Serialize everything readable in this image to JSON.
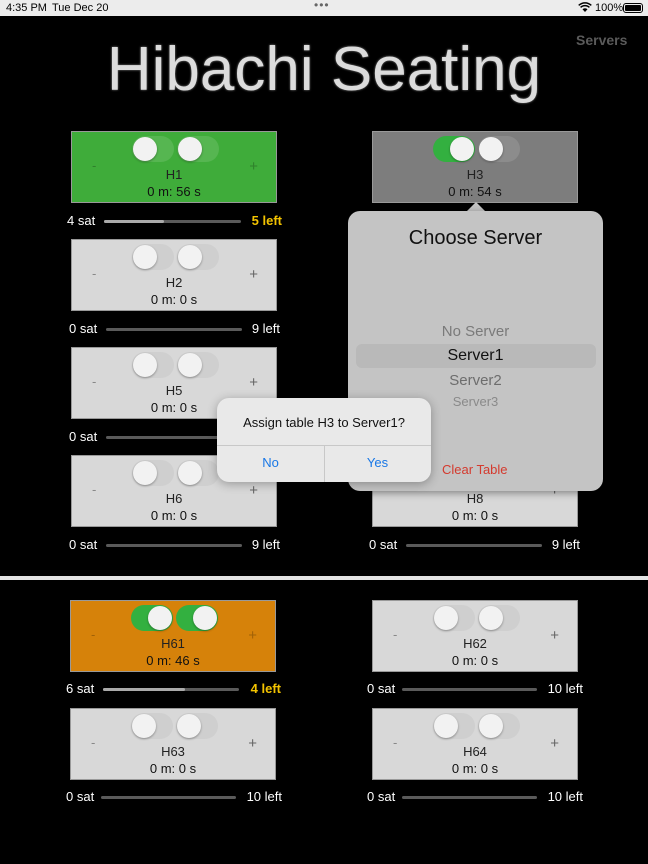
{
  "status_bar": {
    "time": "4:35 PM",
    "date": "Tue Dec 20",
    "battery": "100%"
  },
  "header": {
    "servers_link": "Servers",
    "title": "Hibachi Seating"
  },
  "tables": [
    {
      "name": "H1",
      "timer": "0 m: 56 s",
      "sat": "4 sat",
      "left": "5 left",
      "fill": 0.44,
      "toggle1": false,
      "toggle2": false
    },
    {
      "name": "H3",
      "timer": "0 m: 54 s",
      "toggle1": true,
      "toggle2": false
    },
    {
      "name": "H2",
      "timer": "0 m: 0 s",
      "sat": "0 sat",
      "left": "9 left",
      "fill": 0,
      "toggle1": false,
      "toggle2": false
    },
    {
      "name": "H5",
      "timer": "0 m: 0 s",
      "sat": "0 sat",
      "fill": 0,
      "toggle1": false,
      "toggle2": false
    },
    {
      "name": "H6",
      "timer": "0 m: 0 s",
      "sat": "0 sat",
      "left": "9 left",
      "fill": 0,
      "toggle1": false,
      "toggle2": false
    },
    {
      "name": "H8",
      "timer": "0 m: 0 s",
      "sat": "0 sat",
      "left": "9 left",
      "fill": 0
    },
    {
      "name": "H61",
      "timer": "0 m: 46 s",
      "sat": "6 sat",
      "left": "4 left",
      "fill": 0.6,
      "toggle1": true,
      "toggle2": true
    },
    {
      "name": "H62",
      "timer": "0 m: 0 s",
      "sat": "0 sat",
      "left": "10 left",
      "fill": 0,
      "toggle1": false,
      "toggle2": false
    },
    {
      "name": "H63",
      "timer": "0 m: 0 s",
      "sat": "0 sat",
      "left": "10 left",
      "fill": 0,
      "toggle1": false,
      "toggle2": false
    },
    {
      "name": "H64",
      "timer": "0 m: 0 s",
      "sat": "0 sat",
      "left": "10 left",
      "fill": 0,
      "toggle1": false,
      "toggle2": false
    }
  ],
  "controls": {
    "minus": "-",
    "plus": "+"
  },
  "popover": {
    "heading": "Choose Server",
    "options": [
      "No Server",
      "Server1",
      "Server2",
      "Server3"
    ],
    "selected": "Server1",
    "clear": "Clear Table"
  },
  "alert": {
    "message": "Assign table H3 to Server1?",
    "no": "No",
    "yes": "Yes"
  },
  "colors": {
    "occupied": "#3fac3a",
    "selected": "#7d7d7d",
    "warning": "#d6820a",
    "left_warn": "#f3c300",
    "link": "#1877e6",
    "danger": "#d43a2e"
  }
}
